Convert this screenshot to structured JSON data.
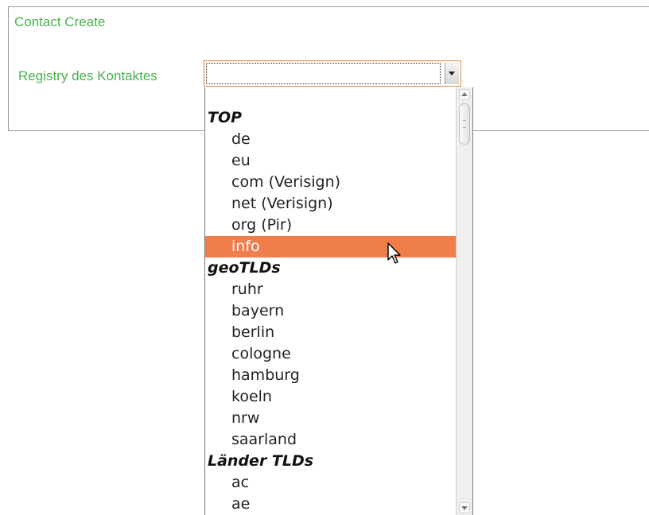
{
  "panel": {
    "title": "Contact Create",
    "field_label": "Registry des Kontaktes"
  },
  "select": {
    "value": ""
  },
  "dropdown": {
    "groups": [
      {
        "label": "TOP",
        "options": [
          "de",
          "eu",
          "com (Verisign)",
          "net (Verisign)",
          "org (Pir)",
          "info"
        ]
      },
      {
        "label": "geoTLDs",
        "options": [
          "ruhr",
          "bayern",
          "berlin",
          "cologne",
          "hamburg",
          "koeln",
          "nrw",
          "saarland"
        ]
      },
      {
        "label": "Länder TLDs",
        "options": [
          "ac",
          "ae"
        ]
      }
    ],
    "highlighted_option": "info"
  },
  "colors": {
    "label_green": "#4caf50",
    "highlight": "#f07e4a",
    "focus_border": "#e0873c"
  }
}
